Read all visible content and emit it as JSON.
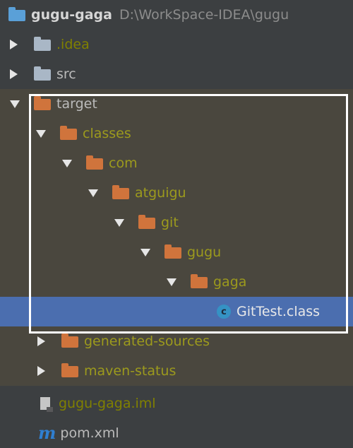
{
  "project": {
    "name": "gugu-gaga",
    "path": "D:\\WorkSpace-IDEA\\gugu"
  },
  "tree": {
    "idea": ".idea",
    "src": "src",
    "target": "target",
    "classes": "classes",
    "com": "com",
    "atguigu": "atguigu",
    "git": "git",
    "gugu": "gugu",
    "gaga": "gaga",
    "gittest": "GitTest.class",
    "gittest_icon_letter": "c",
    "generated_sources": "generated-sources",
    "maven_status": "maven-status",
    "iml": "gugu-gaga.iml",
    "pom": "pom.xml",
    "pom_icon_letter": "m"
  },
  "icons": {
    "project": "project-module-icon",
    "folder": "folder-icon",
    "class_file": "class-file-icon",
    "iml_file": "iml-file-icon",
    "maven": "maven-pom-icon"
  },
  "colors": {
    "background": "#3c3f41",
    "excluded_background": "#4a473e",
    "selected_background": "#4b6eaf",
    "excluded_text": "#808000",
    "folder_orange": "#d0743c",
    "highlight_border": "#ffffff"
  }
}
